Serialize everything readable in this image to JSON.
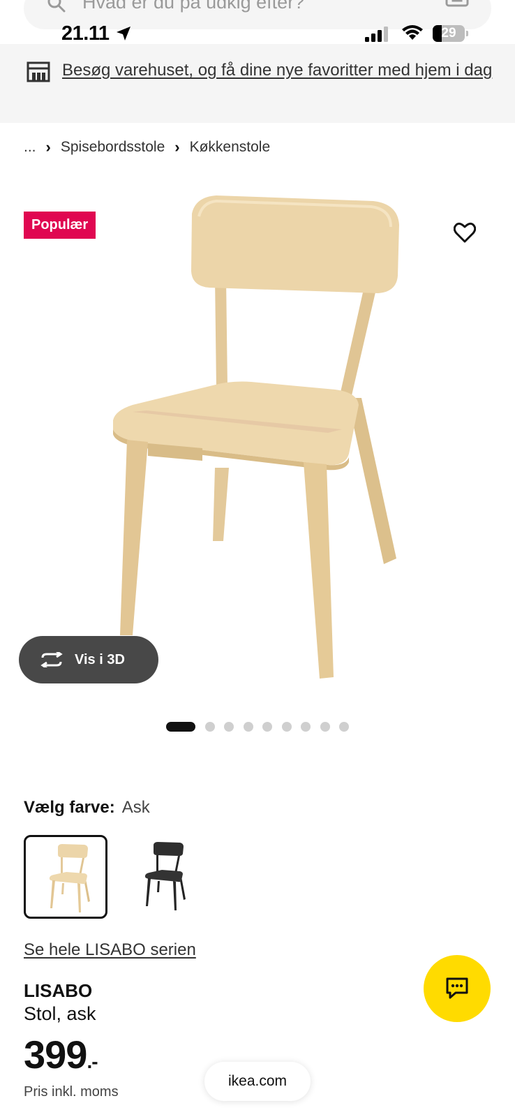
{
  "search": {
    "placeholder": "Hvad er du på udkig efter?"
  },
  "status_bar": {
    "time": "21.11",
    "battery_percent": 29,
    "battery_label": "29"
  },
  "banner": {
    "text": "Besøg varehuset, og få dine nye favoritter med hjem i dag"
  },
  "breadcrumb": {
    "ellipsis": "...",
    "items": [
      "Spisebordsstole",
      "Køkkenstole"
    ],
    "separator": "›"
  },
  "product_image": {
    "badge": "Populær",
    "vis3d_label": "Vis i 3D",
    "carousel": {
      "total": 9,
      "active_index": 0
    }
  },
  "color": {
    "label": "Vælg farve:",
    "selected": "Ask",
    "options": [
      {
        "name": "Ask",
        "hex": "#e6cfa3",
        "selected": true
      },
      {
        "name": "Sort",
        "hex": "#2b2b2b",
        "selected": false
      }
    ]
  },
  "series_link": "Se hele LISABO serien",
  "product": {
    "name": "LISABO",
    "description": "Stol, ask",
    "price": "399",
    "price_suffix": ".-",
    "price_note": "Pris inkl. moms"
  },
  "browser": {
    "url": "ikea.com"
  },
  "colors": {
    "badge": "#e00751",
    "chat": "#ffdb00",
    "vis3d_bg": "#484848",
    "banner_bg": "#f5f5f5"
  }
}
